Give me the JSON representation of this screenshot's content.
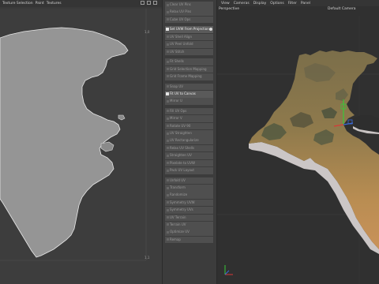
{
  "uv_editor": {
    "menu": [
      "Texture Selection",
      "Paint",
      "Textures"
    ],
    "corner_top_right": "1,0",
    "corner_bottom_right": "1,1"
  },
  "commands": [
    {
      "label": "Clear UV Pins"
    },
    {
      "label": "Relax UV Pins"
    },
    {
      "label": "Cube UV Ops"
    },
    {
      "label": "Set UVW From Projection",
      "highlight": true,
      "gap": true
    },
    {
      "label": "UV Shell Align"
    },
    {
      "label": "UV Peel Unfold"
    },
    {
      "label": "UV Stitch"
    },
    {
      "label": "Fit Shells",
      "gap": true
    },
    {
      "label": "Grid Selection Mapping"
    },
    {
      "label": "Grid Frame Mapping"
    },
    {
      "label": "Snap UV",
      "gap": true
    },
    {
      "label": "Fit UV to Canvas",
      "highlight": true
    },
    {
      "label": "Mirror U"
    },
    {
      "label": "Fill UV Ops",
      "gap": true
    },
    {
      "label": "Mirror V"
    },
    {
      "label": "Rotate UV 90"
    },
    {
      "label": "UV Straighten"
    },
    {
      "label": "UV Rectangularize"
    },
    {
      "label": "Relax UV Shells"
    },
    {
      "label": "Straighten UV"
    },
    {
      "label": "Pixelate to UVW"
    },
    {
      "label": "Pack UV Layout"
    },
    {
      "label": "Unfold UV",
      "gap": true
    },
    {
      "label": "Transform"
    },
    {
      "label": "Randomize"
    },
    {
      "label": "Symmetry UVW"
    },
    {
      "label": "Symmetry UVs"
    },
    {
      "label": "UV Terrain"
    },
    {
      "label": "Terrain UV"
    },
    {
      "label": "Optimize UV"
    },
    {
      "label": "Remap"
    }
  ],
  "viewport": {
    "menu": [
      "View",
      "Cameras",
      "Display",
      "Options",
      "Filter",
      "Panel"
    ],
    "label": "Perspective",
    "camera": "Default Camera"
  },
  "colors": {
    "uv_fill": "#959595",
    "terrain_top": "#a88a52",
    "terrain_dark": "#5a5a3e",
    "terrain_side": "#cbc6c6",
    "axis_y": "#38c838",
    "axis_z": "#3a6ad8",
    "axis_x": "#d83838"
  }
}
